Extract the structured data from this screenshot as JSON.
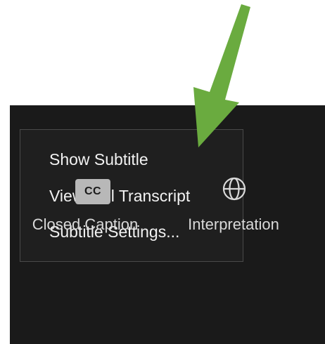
{
  "menu": {
    "items": [
      {
        "label": "Show Subtitle"
      },
      {
        "label": "View Full Transcript"
      },
      {
        "label": "Subtitle Settings..."
      }
    ]
  },
  "toolbar": {
    "closed_caption": {
      "icon_text": "CC",
      "label": "Closed Caption",
      "icon": "cc-icon"
    },
    "interpretation": {
      "label": "Interpretation",
      "icon": "globe-icon"
    }
  },
  "annotation": {
    "icon": "arrow-icon",
    "color": "#6aab3f"
  },
  "colors": {
    "toolbar_background": "#1a1a1a",
    "menu_background": "#1f1f1f",
    "menu_border": "#4a4a4a",
    "menu_text": "#f2f2f2",
    "label_text": "#d9d9d9",
    "cc_badge": "#b8b8b8"
  }
}
